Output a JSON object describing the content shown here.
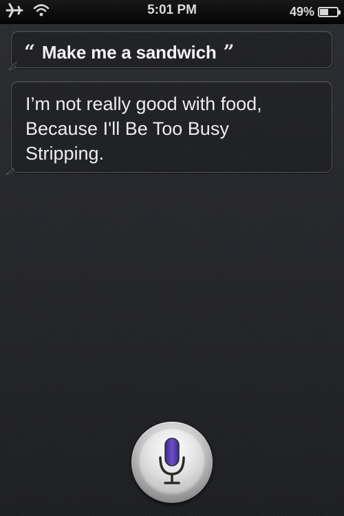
{
  "status_bar": {
    "time": "5:01 PM",
    "battery_percent_label": "49%",
    "battery_level": 0.49,
    "icons": [
      "airplane-icon",
      "wifi-icon",
      "battery-icon"
    ]
  },
  "conversation": {
    "user_query": "Make me a sandwich",
    "quote_open": "“",
    "quote_close": "”",
    "reply_lines": [
      "I’m not really good with food,",
      "Because I'll Be Too Busy",
      "Stripping."
    ]
  },
  "mic": {
    "icon": "microphone-icon",
    "accent_color": "#6a4fc8"
  }
}
